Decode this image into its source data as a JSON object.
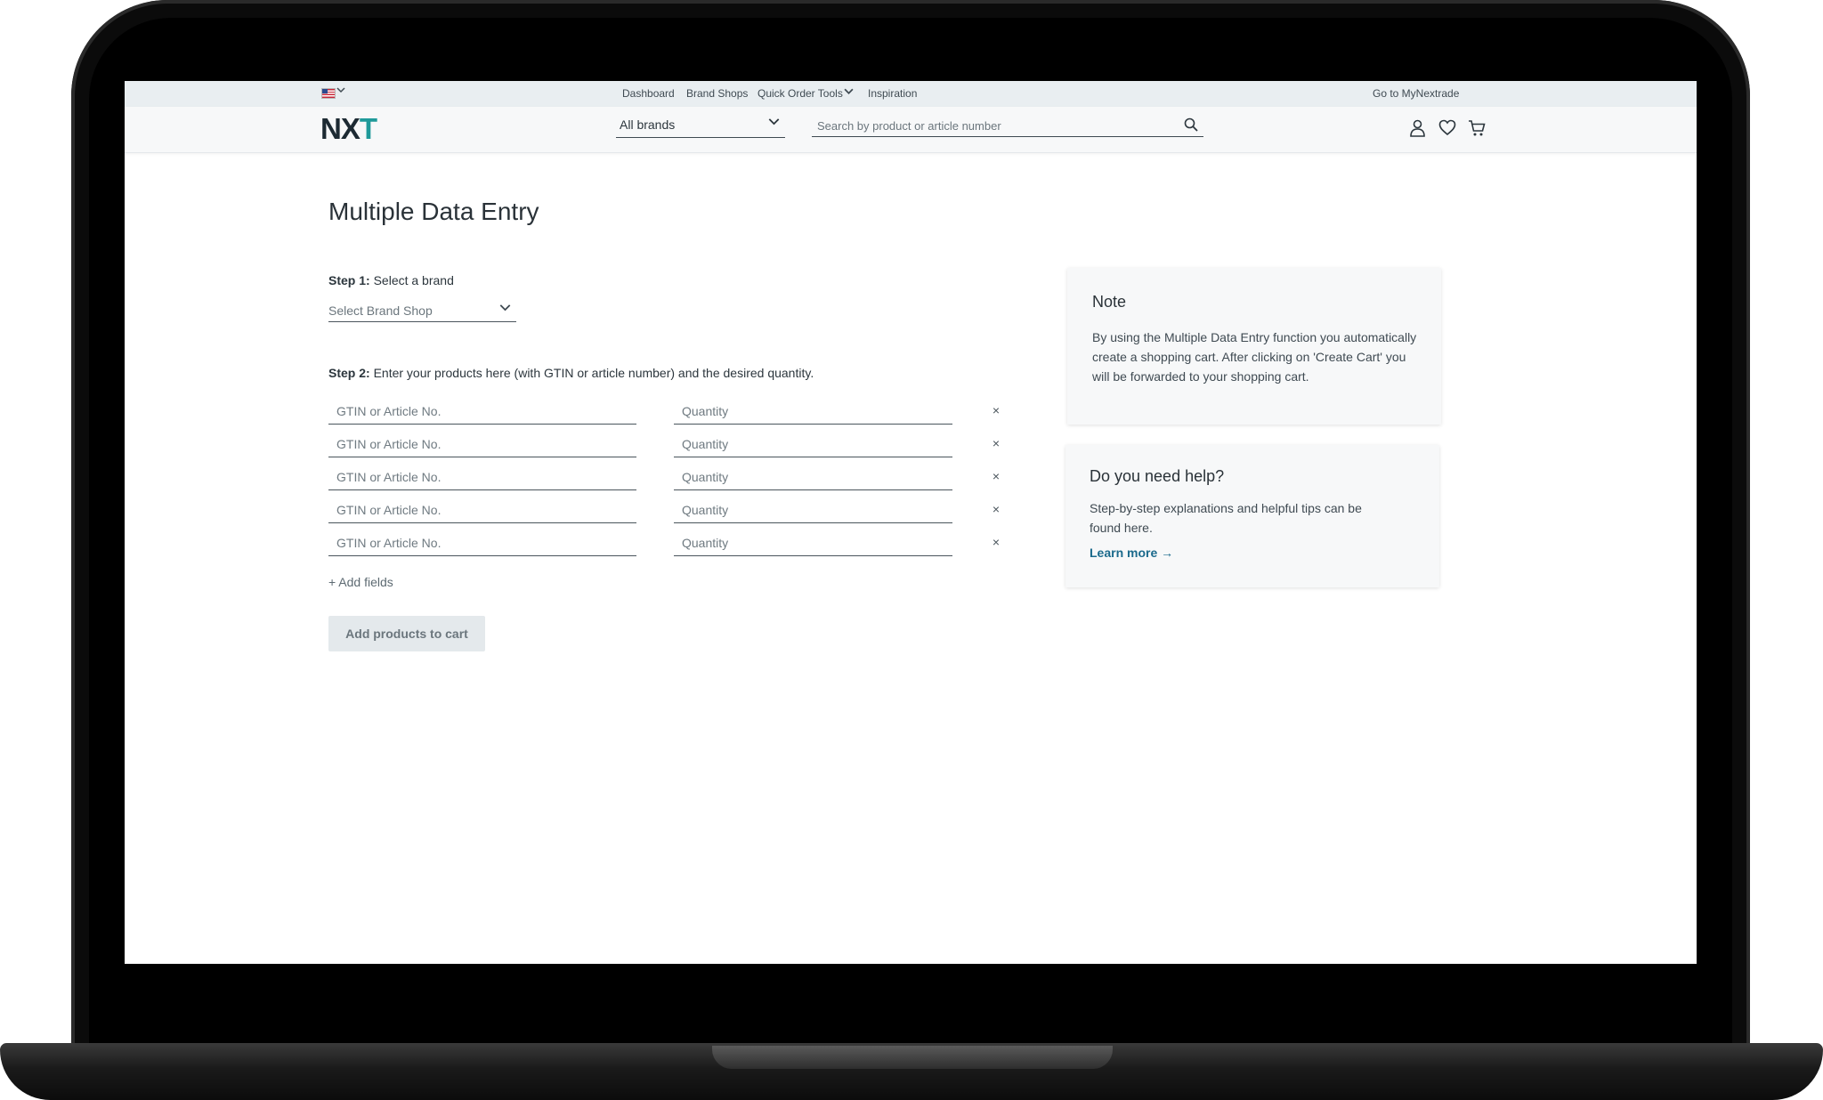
{
  "topbar": {
    "nav": [
      {
        "label": "Dashboard"
      },
      {
        "label": "Brand Shops"
      },
      {
        "label": "Quick Order Tools"
      },
      {
        "label": "Inspiration"
      }
    ],
    "quick_order_chevron": "⌄",
    "go_to": "Go to MyNextrade"
  },
  "header": {
    "logo_nx": "NX",
    "logo_t": "T",
    "brand_select": {
      "value": "All brands"
    },
    "search": {
      "placeholder": "Search by product or article number"
    },
    "icons": [
      "user-icon",
      "heart-icon",
      "cart-icon"
    ]
  },
  "main": {
    "title": "Multiple Data Entry",
    "step1": {
      "label": "Step 1:",
      "text": "Select a brand"
    },
    "brand_shop_select": {
      "value": "Select Brand Shop"
    },
    "step2": {
      "label": "Step 2:",
      "text": "Enter your products here (with GTIN or article number) and the desired quantity."
    },
    "rows": [
      {
        "gtin_placeholder": "GTIN or Article No.",
        "qty_placeholder": "Quantity"
      },
      {
        "gtin_placeholder": "GTIN or Article No.",
        "qty_placeholder": "Quantity"
      },
      {
        "gtin_placeholder": "GTIN or Article No.",
        "qty_placeholder": "Quantity"
      },
      {
        "gtin_placeholder": "GTIN or Article No.",
        "qty_placeholder": "Quantity"
      },
      {
        "gtin_placeholder": "GTIN or Article No.",
        "qty_placeholder": "Quantity"
      }
    ],
    "remove_symbol": "×",
    "add_fields": "+ Add fields",
    "add_to_cart": "Add products to cart"
  },
  "note": {
    "title": "Note",
    "body": "By using the Multiple Data Entry function you automatically create a shopping cart. After clicking on 'Create Cart' you will be forwarded to your shopping cart."
  },
  "help": {
    "title": "Do you need help?",
    "body": "Step-by-step explanations and helpful tips can be found here.",
    "link": "Learn more →"
  },
  "colors": {
    "accent": "#1f9a9a",
    "link": "#1b6a8c",
    "topbar_bg": "#e9eef1",
    "button_bg": "#e4e9ec"
  }
}
